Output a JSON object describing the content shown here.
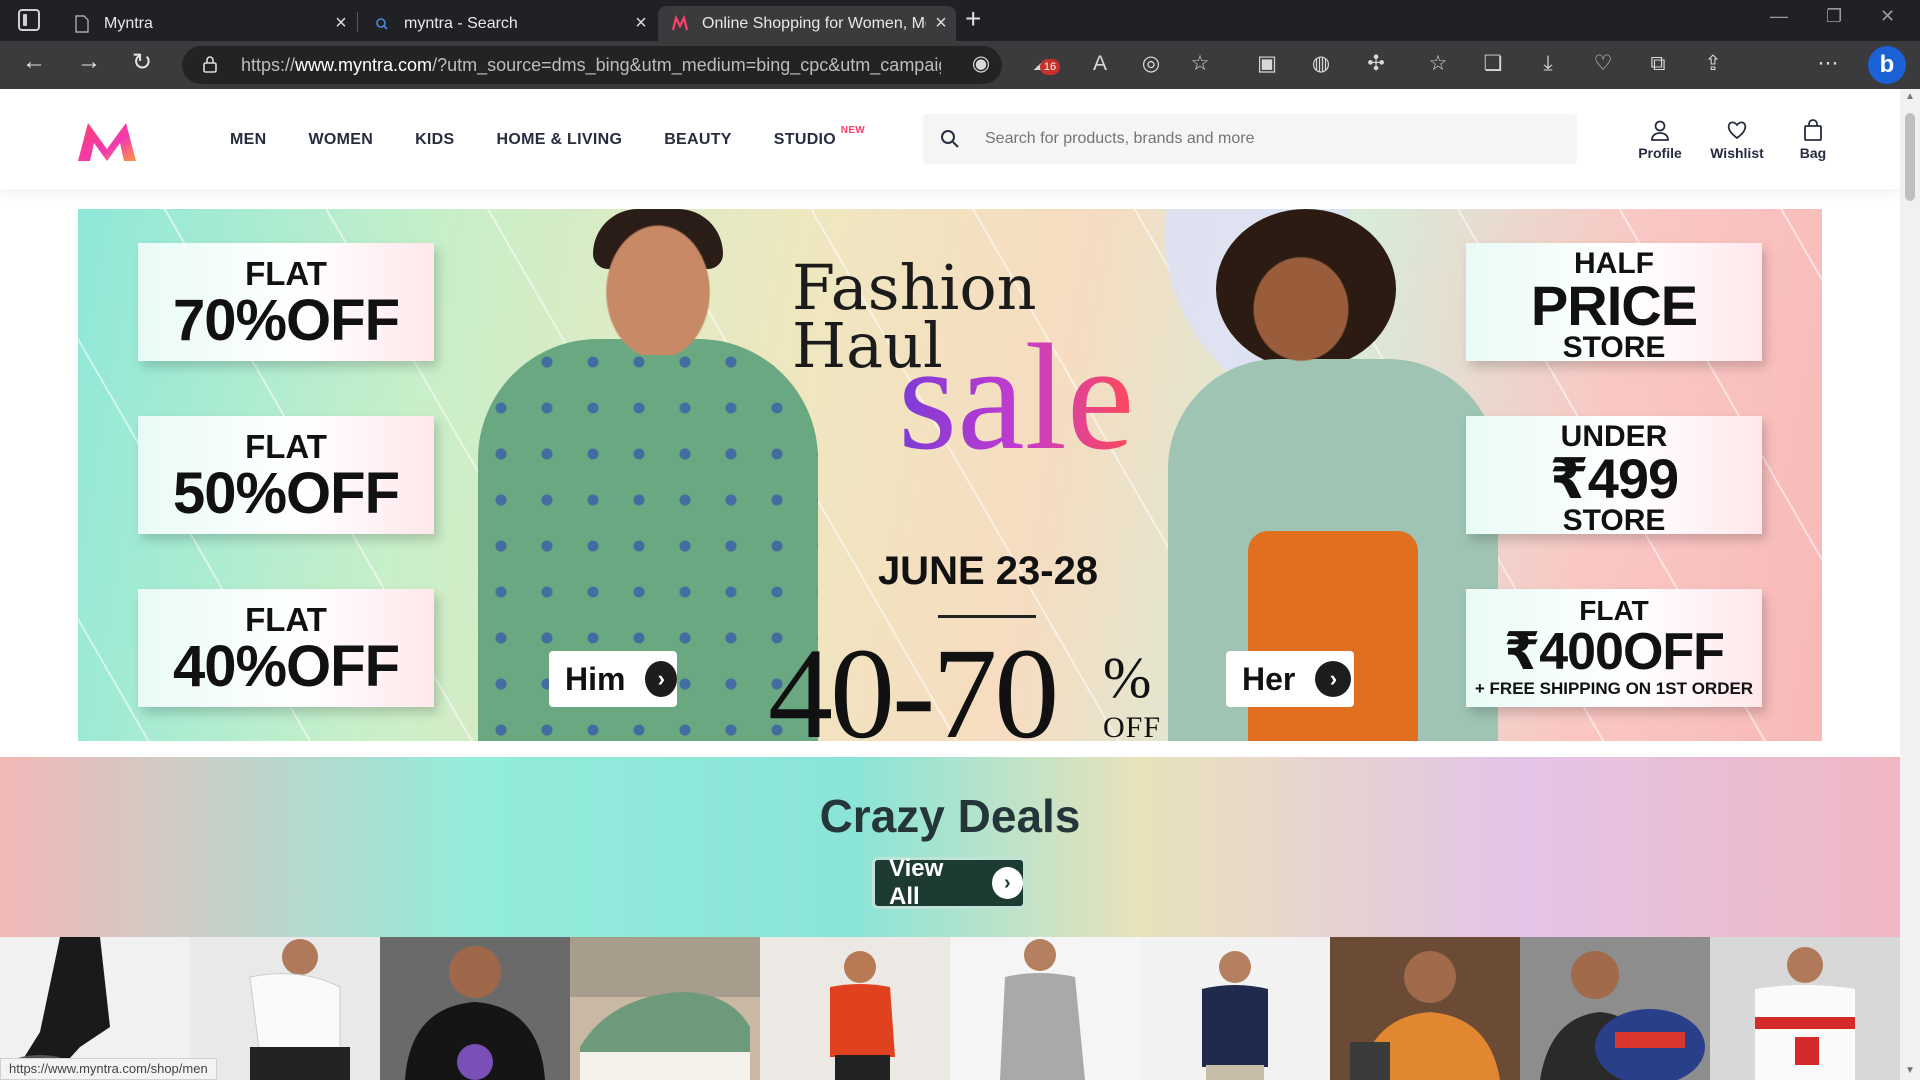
{
  "browser": {
    "tabs": [
      {
        "title": "Myntra",
        "active": false
      },
      {
        "title": "myntra - Search",
        "active": false
      },
      {
        "title": "Online Shopping for Women, Me",
        "active": true
      }
    ],
    "url_prefix": "https://",
    "url_domain": "www.myntra.com",
    "url_rest": "/?utm_source=dms_bing&utm_medium=bing_cpc&utm_campaig...",
    "extension_badge": "16",
    "status_url": "https://www.myntra.com/shop/men"
  },
  "header": {
    "nav": [
      "MEN",
      "WOMEN",
      "KIDS",
      "HOME & LIVING",
      "BEAUTY",
      "STUDIO"
    ],
    "studio_badge": "NEW",
    "search_placeholder": "Search for products, brands and more",
    "actions": {
      "profile": "Profile",
      "wishlist": "Wishlist",
      "bag": "Bag"
    }
  },
  "banner": {
    "left_offers": [
      {
        "small": "FLAT",
        "big": "70%OFF"
      },
      {
        "small": "FLAT",
        "big": "50%OFF"
      },
      {
        "small": "FLAT",
        "big": "40%OFF"
      }
    ],
    "right_offers": [
      {
        "top": "HALF",
        "big": "PRICE",
        "bottom": "STORE"
      },
      {
        "top": "UNDER",
        "big": "₹499",
        "bottom": "STORE"
      },
      {
        "top": "FLAT",
        "big": "₹400OFF",
        "bottom": "+ FREE SHIPPING ON 1ST ORDER"
      }
    ],
    "headline": {
      "line1": "Fashion",
      "line2": "Haul",
      "sale": "sale",
      "dates": "JUNE 23-28",
      "range": "40-70",
      "percent": "%",
      "off": "OFF"
    },
    "cta_him": "Him",
    "cta_her": "Her"
  },
  "deals": {
    "title": "Crazy Deals",
    "view_all": "View All"
  },
  "colors": {
    "brand_pink": "#ff3f6c",
    "nav_text": "#282c3f",
    "deals_button": "#1d3a33"
  }
}
